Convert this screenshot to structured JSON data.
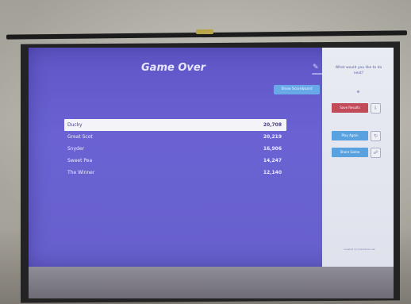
{
  "game": {
    "title": "Game Over",
    "show_button_label": "Show Scoreboard"
  },
  "leaderboard": [
    {
      "name": "Ducky",
      "score": "20,708"
    },
    {
      "name": "Great Scot",
      "score": "20,219"
    },
    {
      "name": "Snyder",
      "score": "16,906"
    },
    {
      "name": "Sweet Pea",
      "score": "14,247"
    },
    {
      "name": "The Winner",
      "score": "12,140"
    }
  ],
  "side_panel": {
    "question": "What would you like to do next?",
    "save_label": "Save Results",
    "play_again_label": "Play Again",
    "share_label": "Share Game",
    "footer": "Created On ClassTools.net"
  },
  "colors": {
    "screen": "#6660cc",
    "save": "#c24b5a",
    "action": "#5aa2df"
  }
}
